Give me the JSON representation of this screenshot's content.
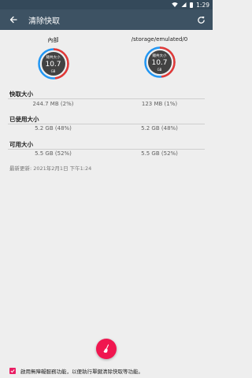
{
  "status_bar": {
    "time": "1:29"
  },
  "app_bar": {
    "title": "清除快取"
  },
  "volumes": [
    {
      "name": "內部",
      "gauge_label": "總共大小",
      "gauge_value": "10.7",
      "gauge_unit": "GB"
    },
    {
      "name": "/storage/emulated/0",
      "gauge_label": "總共大小",
      "gauge_value": "10.7",
      "gauge_unit": "GB"
    }
  ],
  "sections": [
    {
      "title": "快取大小",
      "values": [
        "244.7 MB (2%)",
        "123 MB (1%)"
      ]
    },
    {
      "title": "已使用大小",
      "values": [
        "5.2 GB (48%)",
        "5.2 GB (48%)"
      ]
    },
    {
      "title": "可用大小",
      "values": [
        "5.5 GB (52%)",
        "5.5 GB (52%)"
      ]
    }
  ],
  "last_updated": "最新更新: 2021年2月1日 下午1:24",
  "accessibility": {
    "label": "啟用無障礙服務功能，以便執行單鍵清除快取等功能。",
    "checked": true
  },
  "colors": {
    "appbar": "#3d5263",
    "statusbar": "#34495a",
    "accent": "#f0164f",
    "gauge_ring": "#2196f3",
    "gauge_used": "#e53935",
    "gauge_inner": "#424242"
  }
}
